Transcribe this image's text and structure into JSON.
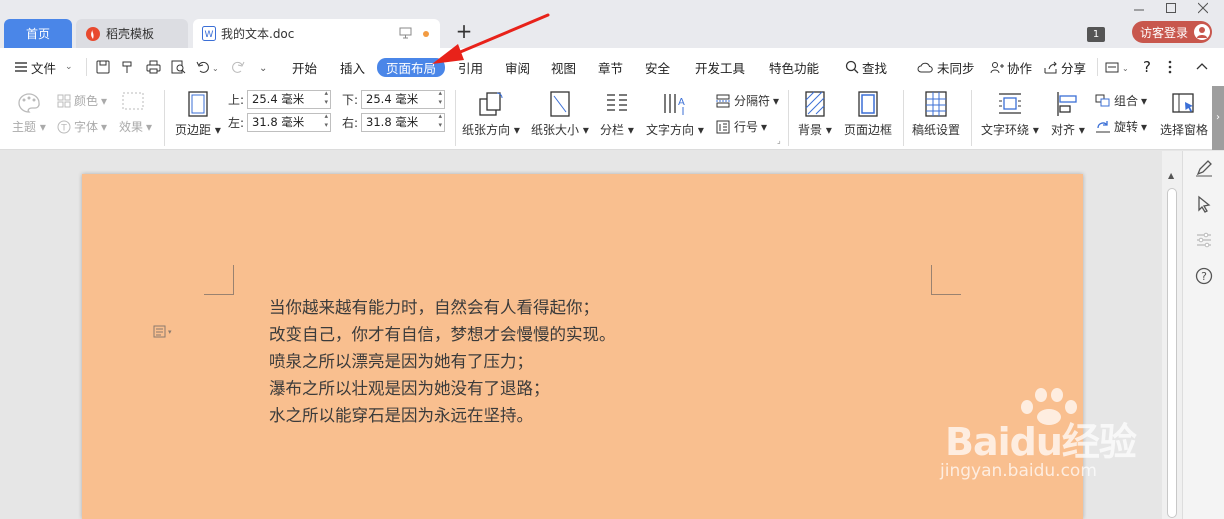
{
  "tabs": {
    "home": "首页",
    "templates": "稻壳模板",
    "document": "我的文本.doc"
  },
  "titlebar": {
    "page_badge": "1",
    "login": "访客登录"
  },
  "menu": {
    "file": "文件",
    "items": [
      "开始",
      "插入",
      "页面布局",
      "引用",
      "审阅",
      "视图",
      "章节",
      "安全",
      "开发工具",
      "特色功能"
    ],
    "search": "查找",
    "sync": "未同步",
    "collab": "协作",
    "share": "分享"
  },
  "ribbon": {
    "theme": "主题",
    "colors": "颜色",
    "fonts": "字体",
    "effects": "效果",
    "margins": "页边距",
    "margin_top_label": "上:",
    "margin_top_value": "25.4 毫米",
    "margin_bottom_label": "下:",
    "margin_bottom_value": "25.4 毫米",
    "margin_left_label": "左:",
    "margin_left_value": "31.8 毫米",
    "margin_right_label": "右:",
    "margin_right_value": "31.8 毫米",
    "orientation": "纸张方向",
    "size": "纸张大小",
    "columns": "分栏",
    "text_direction": "文字方向",
    "breaks": "分隔符",
    "line_numbers": "行号",
    "background": "背景",
    "page_border": "页面边框",
    "manuscript": "稿纸设置",
    "wrap": "文字环绕",
    "align": "对齐",
    "group": "组合",
    "rotate": "旋转",
    "selection_pane": "选择窗格"
  },
  "document": {
    "lines": [
      "当你越来越有能力时，自然会有人看得起你；",
      "改变自己，你才有自信，梦想才会慢慢的实现。",
      "喷泉之所以漂亮是因为她有了压力；",
      "瀑布之所以壮观是因为她没有了退路；",
      "水之所以能穿石是因为永远在坚持。"
    ],
    "page_color": "#f9bf8f"
  },
  "colors": {
    "accent": "#4a86e8",
    "login": "#c8574d",
    "arrow": "#e8221a"
  },
  "watermark": {
    "brand": "Baidu经验",
    "url": "jingyan.baidu.com"
  }
}
